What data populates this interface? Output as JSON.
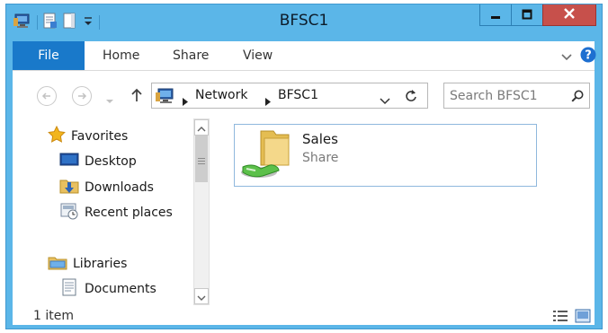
{
  "window": {
    "title": "BFSC1"
  },
  "ribbon": {
    "tabs": [
      "File",
      "Home",
      "Share",
      "View"
    ]
  },
  "address": {
    "segments": [
      "Network",
      "BFSC1"
    ]
  },
  "search": {
    "placeholder": "Search BFSC1"
  },
  "navigation": {
    "favorites_label": "Favorites",
    "favorites": [
      "Desktop",
      "Downloads",
      "Recent places"
    ],
    "libraries_label": "Libraries",
    "libraries": [
      "Documents"
    ]
  },
  "content": {
    "items": [
      {
        "name": "Sales",
        "type": "Share"
      }
    ]
  },
  "status": {
    "text": "1 item"
  },
  "colors": {
    "titlebar": "#5bb6e8",
    "file_tab": "#1979ca",
    "close_button": "#c7504b",
    "selection_border": "#8fb8dd"
  }
}
